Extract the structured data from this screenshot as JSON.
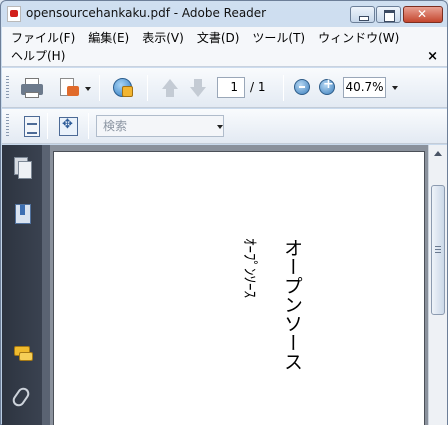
{
  "window": {
    "title": "opensourcehankaku.pdf - Adobe Reader"
  },
  "menu": {
    "items": [
      "ファイル(F)",
      "編集(E)",
      "表示(V)",
      "文書(D)",
      "ツール(T)",
      "ウィンドウ(W)"
    ],
    "help": "ヘルプ(H)",
    "close_glyph": "×"
  },
  "toolbar": {
    "page_current": "1",
    "page_total": "/ 1",
    "zoom": "40.7%",
    "search_placeholder": "検索"
  },
  "icons": {
    "print": "printer-icon",
    "share": "create-pdf-icon",
    "collaborate": "globe-icon",
    "prev": "previous-page-icon",
    "next": "next-page-icon",
    "zoom_out": "zoom-out-icon",
    "zoom_in": "zoom-in-icon",
    "fit": "fit-page-icon",
    "expand": "full-screen-icon"
  },
  "document": {
    "line1": "オープンソース",
    "line2": "ｵｰﾌﾟﾝｿｰｽ"
  }
}
